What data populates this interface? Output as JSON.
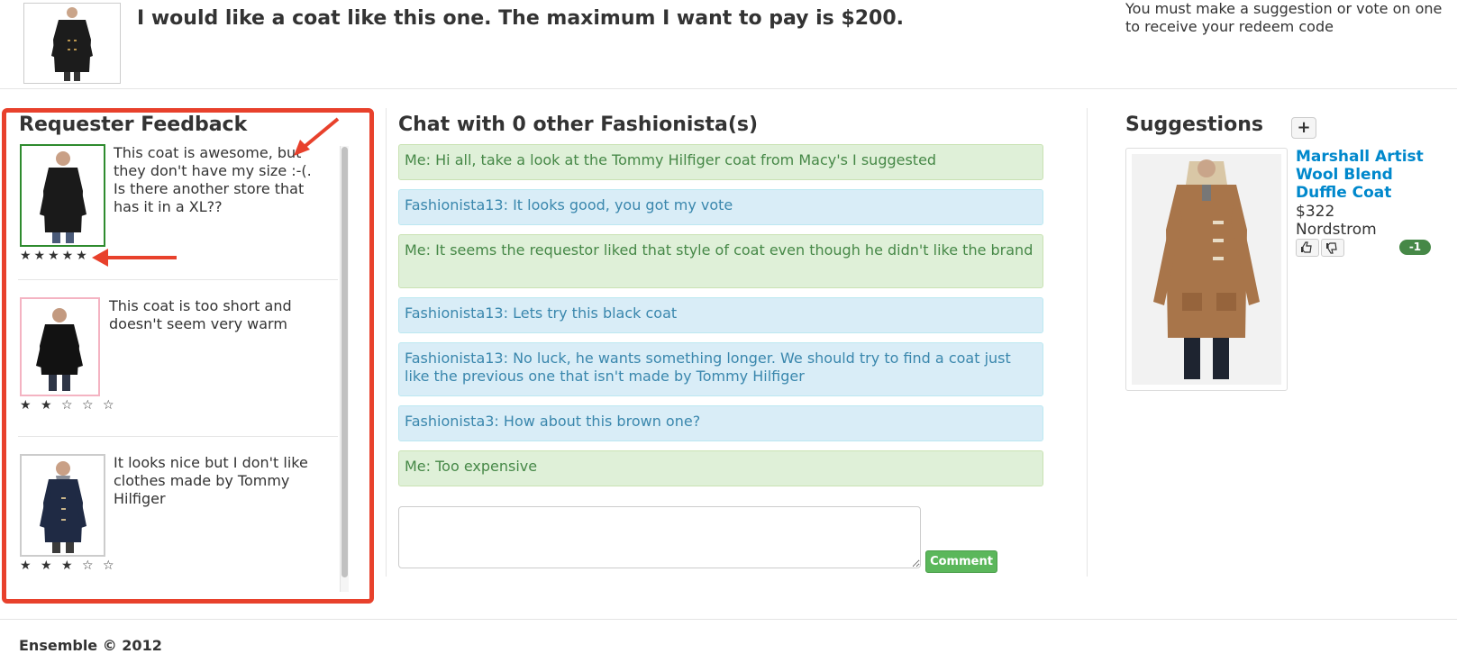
{
  "header": {
    "request_text": "I would like a coat like this one. The maximum I want to pay is $200.",
    "redeem_note": "You must make a suggestion or vote on one to receive your redeem code"
  },
  "feedback": {
    "title": "Requester Feedback",
    "items": [
      {
        "text": "This coat is awesome, but they don't have my size :-(. Is there another store that has it in a XL??",
        "stars": "★★★★★",
        "rating": 5
      },
      {
        "text": "This coat is too short and doesn't seem very warm",
        "stars": "★ ★ ☆ ☆ ☆",
        "rating": 2
      },
      {
        "text": "It looks nice but I don't like clothes made by Tommy Hilfiger",
        "stars": "★ ★ ★ ☆ ☆",
        "rating": 3
      }
    ]
  },
  "chat": {
    "title": "Chat with 0 other Fashionista(s)",
    "messages": [
      {
        "sender": "me",
        "text": "Me: Hi all, take a look at the Tommy Hilfiger coat from Macy's I suggested"
      },
      {
        "sender": "other",
        "text": "Fashionista13: It looks good, you got my vote"
      },
      {
        "sender": "me",
        "text": "Me: It seems the requestor liked that style of coat even though he didn't like the brand"
      },
      {
        "sender": "other",
        "text": "Fashionista13: Lets try this black coat"
      },
      {
        "sender": "other",
        "text": "Fashionista13: No luck, he wants something longer. We should try to find a coat just like the previous one that isn't made by Tommy Hilfiger"
      },
      {
        "sender": "other",
        "text": "Fashionista3: How about this brown one?"
      },
      {
        "sender": "me",
        "text": "Me: Too expensive"
      }
    ],
    "input_value": "",
    "comment_label": "Comment"
  },
  "suggestions": {
    "title": "Suggestions",
    "add_label": "+",
    "items": [
      {
        "name": "Marshall Artist Wool Blend Duffle Coat",
        "price": "$322",
        "store": "Nordstrom",
        "votes": "-1"
      }
    ]
  },
  "footer": {
    "text": "Ensemble © 2012"
  },
  "colors": {
    "annotation_red": "#e8412c",
    "me_bg": "#dff0d8",
    "other_bg": "#d9edf7",
    "link": "#0088cc",
    "button_green": "#5bb75b"
  }
}
